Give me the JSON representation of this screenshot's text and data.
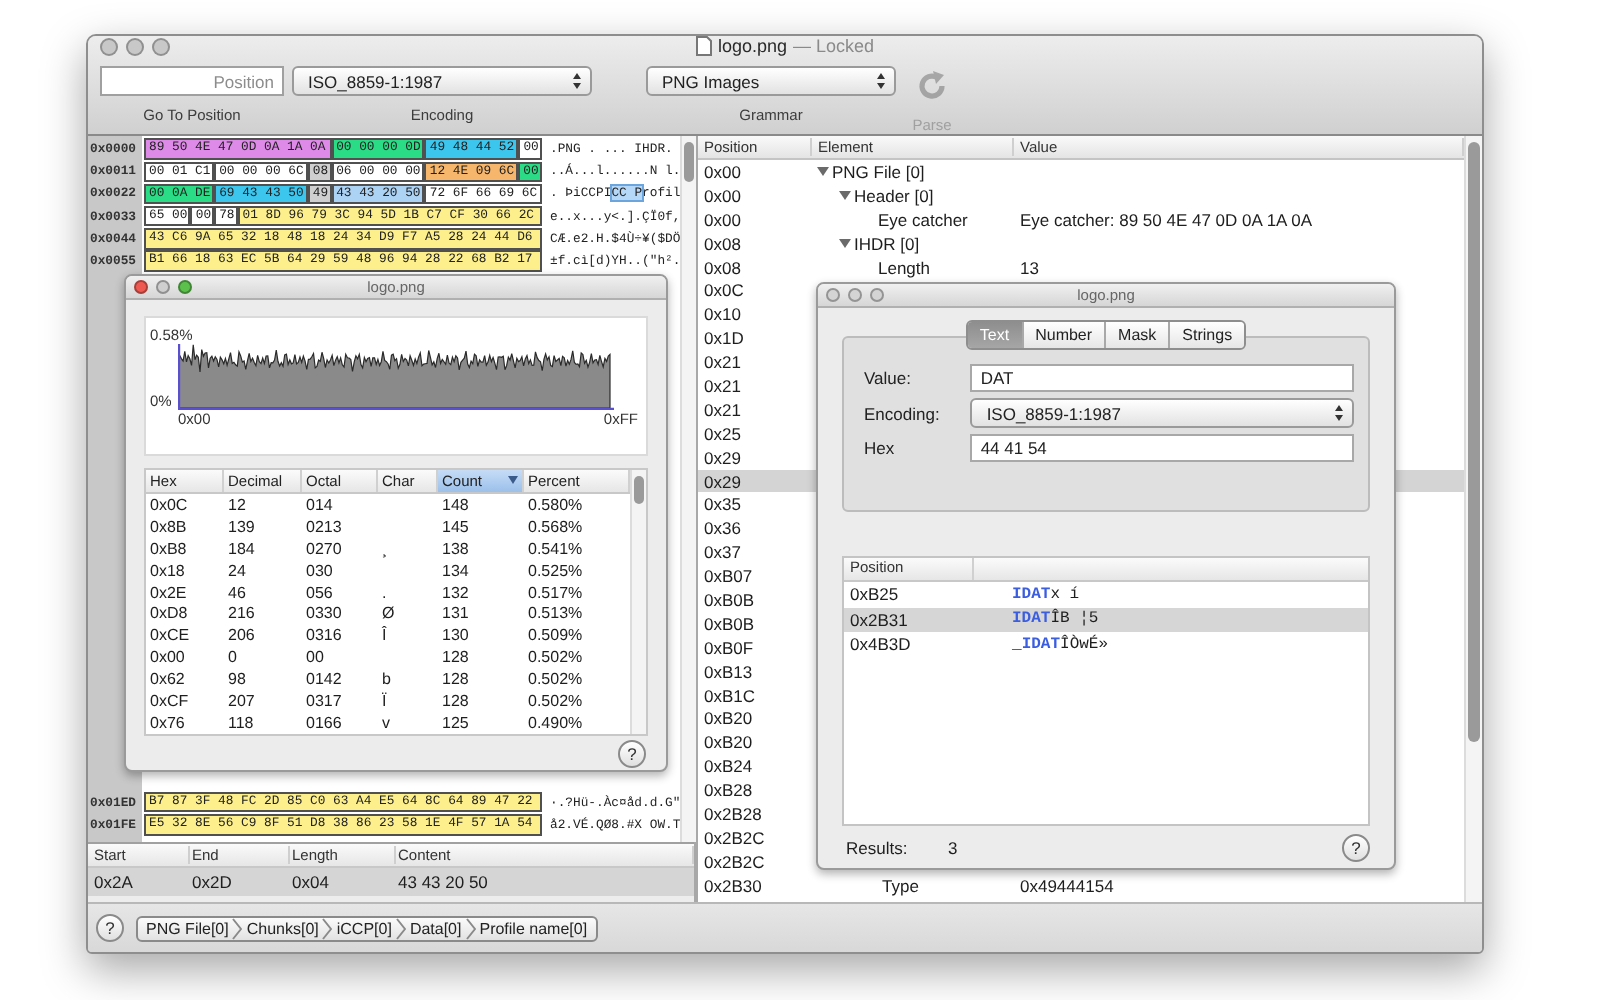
{
  "window": {
    "title": "logo.png",
    "status": "— Locked"
  },
  "toolbar": {
    "position_field": {
      "placeholder": "Position",
      "label": "Go To Position"
    },
    "encoding": {
      "value": "ISO_8859-1:1987",
      "label": "Encoding"
    },
    "grammar": {
      "value": "PNG Images",
      "label": "Grammar"
    },
    "parse": {
      "label": "Parse",
      "disabled": true
    }
  },
  "hex_view": {
    "rows_top": [
      {
        "offset": "0x0000",
        "segments": [
          {
            "bytes": "89 50 4E 47 0D 0A 1A 0A",
            "color": "#de8ae8"
          },
          {
            "bytes": "00 00 00 0D",
            "color": "#2bdc86"
          },
          {
            "bytes": "49 48 44 52",
            "color": "#3cc6ee"
          },
          {
            "bytes": "00",
            "color": "#ffffff"
          }
        ],
        "text": [
          {
            "text": ".PNG . ... IHDR.",
            "selected": false
          }
        ]
      },
      {
        "offset": "0x0011",
        "segments": [
          {
            "bytes": "00 01 C1",
            "color": "#ffffff"
          },
          {
            "bytes": "00 00 00 6C",
            "color": "#ffffff"
          },
          {
            "bytes": "08",
            "color": "#cfcfcf"
          },
          {
            "bytes": "06 00 00 00",
            "color": "#ffffff"
          },
          {
            "bytes": "12 4E 09 6C",
            "color": "#f6b66c"
          },
          {
            "bytes": "00",
            "color": "#2bdc86"
          }
        ],
        "text": [
          {
            "text": "..Á...l......N l.",
            "selected": false
          }
        ]
      },
      {
        "offset": "0x0022",
        "segments": [
          {
            "bytes": "00 0A DE",
            "color": "#2bdc86"
          },
          {
            "bytes": "69 43 43 50",
            "color": "#3cc6ee"
          },
          {
            "bytes": "49",
            "color": "#cfcfcf"
          },
          {
            "bytes": "43 43 20 50",
            "color": "#acd2f4"
          },
          {
            "bytes": "72 6F 66 69 6C",
            "color": "#ffffff"
          }
        ],
        "text": [
          {
            "text": ". ÞiCCPI",
            "selected": false
          },
          {
            "text": "CC P",
            "selected": true
          },
          {
            "text": "rofil",
            "selected": false
          }
        ]
      },
      {
        "offset": "0x0033",
        "segments": [
          {
            "bytes": "65 00",
            "color": "#ffffff"
          },
          {
            "bytes": "00",
            "color": "#ffffff"
          },
          {
            "bytes": "78",
            "color": "#ffffff"
          },
          {
            "bytes": "01 8D 96 79 3C 94 5D 1B C7 CF 30 66 2C",
            "color": "#fdf08c"
          }
        ],
        "text": [
          {
            "text": "e..x...y<.].ÇÏ0f,",
            "selected": false
          }
        ]
      },
      {
        "offset": "0x0044",
        "segments": [
          {
            "bytes": "43 C6 9A 65 32 18 48 18 24 34 D9 F7 A5 28 24 44 D6",
            "color": "#fdf08c"
          }
        ],
        "text": [
          {
            "text": "CÆ.e2.H.$4Ù÷¥($DÖ",
            "selected": false
          }
        ]
      },
      {
        "offset": "0x0055",
        "segments": [
          {
            "bytes": "B1 66 18 63 EC 5B 64 29 59 48 96 94 28 22 68 B2 17",
            "color": "#fdf08c"
          }
        ],
        "text": [
          {
            "text": "±f.cì[d)YH..(\"h².",
            "selected": false
          }
        ]
      }
    ],
    "rows_bottom": [
      {
        "offset": "0x01ED",
        "segments": [
          {
            "bytes": "B7 87 3F 48 FC 2D 85 C0 63 A4 E5 64 8C 64 89 47 22",
            "color": "#fdf08c"
          }
        ],
        "text": [
          {
            "text": "·.?Hü-.Àc¤åd.d.G\"",
            "selected": false
          }
        ]
      },
      {
        "offset": "0x01FE",
        "segments": [
          {
            "bytes": "E5 32 8E 56 C9 8F 51 D8 38 86 23 58 1E 4F 57 1A 54",
            "color": "#fdf08c"
          }
        ],
        "text": [
          {
            "text": "å2.VÉ.QØ8.#X OW.T",
            "selected": false
          }
        ]
      }
    ]
  },
  "selection": {
    "columns": [
      "Start",
      "End",
      "Length",
      "Content"
    ],
    "values": [
      "0x2A",
      "0x2D",
      "0x04",
      "43 43 20 50"
    ]
  },
  "bottom_bar": {
    "help": "?",
    "path": [
      "PNG File[0]",
      "Chunks[0]",
      "iCCP[0]",
      "Data[0]",
      "Profile name[0]"
    ]
  },
  "structure": {
    "columns": [
      "Position",
      "Element",
      "Value"
    ],
    "tree": [
      {
        "position": "0x00",
        "element": "PNG File [0]",
        "expanded": true,
        "selected": false,
        "children": [
          {
            "position": "0x00",
            "element": "Header [0]",
            "expanded": true,
            "selected": false,
            "children": [
              {
                "position": "0x00",
                "element": "Eye catcher",
                "value": "Eye catcher: 89 50 4E 47 0D 0A 1A 0A",
                "selected": false
              }
            ]
          },
          {
            "position": "0x08",
            "element": "IHDR [0]",
            "expanded": true,
            "selected": false,
            "children": [
              {
                "position": "0x08",
                "element": "Length",
                "value": "13",
                "selected": false
              }
            ]
          }
        ]
      }
    ],
    "more_rows": [
      {
        "position": "0x0C",
        "selected": false
      },
      {
        "position": "0x10",
        "selected": false
      },
      {
        "position": "0x1D",
        "selected": false
      },
      {
        "position": "0x21",
        "selected": false
      },
      {
        "position": "0x21",
        "selected": false
      },
      {
        "position": "0x21",
        "selected": false
      },
      {
        "position": "0x25",
        "selected": false
      },
      {
        "position": "0x29",
        "selected": false
      },
      {
        "position": "0x29",
        "selected": true
      },
      {
        "position": "0x35",
        "selected": false
      },
      {
        "position": "0x36",
        "selected": false
      },
      {
        "position": "0x37",
        "selected": false
      },
      {
        "position": "0xB07",
        "selected": false
      },
      {
        "position": "0xB0B",
        "selected": false
      },
      {
        "position": "0xB0B",
        "selected": false
      },
      {
        "position": "0xB0F",
        "selected": false
      },
      {
        "position": "0xB13",
        "selected": false
      },
      {
        "position": "0xB1C",
        "selected": false
      },
      {
        "position": "0xB20",
        "selected": false
      },
      {
        "position": "0xB20",
        "selected": false
      },
      {
        "position": "0xB24",
        "selected": false
      },
      {
        "position": "0xB28",
        "selected": false
      },
      {
        "position": "0x2B28",
        "selected": false
      },
      {
        "position": "0x2B2C",
        "selected": false
      },
      {
        "position": "0x2B2C",
        "selected": false
      },
      {
        "position": "0x2B30",
        "element": "Type",
        "value": "0x49444154",
        "selected": false
      }
    ]
  },
  "histogram_window": {
    "title": "logo.png",
    "y_max": "0.58%",
    "y_min": "0%",
    "x_min": "0x00",
    "x_max": "0xFF",
    "columns": [
      {
        "label": "Hex",
        "sorted": false
      },
      {
        "label": "Decimal",
        "sorted": false
      },
      {
        "label": "Octal",
        "sorted": false
      },
      {
        "label": "Char",
        "sorted": false
      },
      {
        "label": "Count",
        "sorted": true
      },
      {
        "label": "Percent",
        "sorted": false
      }
    ],
    "rows": [
      {
        "hex": "0x0C",
        "decimal": "12",
        "octal": "014",
        "count": "148",
        "percent": "0.580%"
      },
      {
        "hex": "0x8B",
        "decimal": "139",
        "octal": "0213",
        "count": "145",
        "percent": "0.568%"
      },
      {
        "hex": "0xB8",
        "decimal": "184",
        "octal": "0270",
        "char": "¸",
        "count": "138",
        "percent": "0.541%"
      },
      {
        "hex": "0x18",
        "decimal": "24",
        "octal": "030",
        "count": "134",
        "percent": "0.525%"
      },
      {
        "hex": "0x2E",
        "decimal": "46",
        "octal": "056",
        "char": ".",
        "count": "132",
        "percent": "0.517%"
      },
      {
        "hex": "0xD8",
        "decimal": "216",
        "octal": "0330",
        "char": "Ø",
        "count": "131",
        "percent": "0.513%"
      },
      {
        "hex": "0xCE",
        "decimal": "206",
        "octal": "0316",
        "char": "Î",
        "count": "130",
        "percent": "0.509%"
      },
      {
        "hex": "0x00",
        "decimal": "0",
        "octal": "00",
        "count": "128",
        "percent": "0.502%"
      },
      {
        "hex": "0x62",
        "decimal": "98",
        "octal": "0142",
        "char": "b",
        "count": "128",
        "percent": "0.502%"
      },
      {
        "hex": "0xCF",
        "decimal": "207",
        "octal": "0317",
        "char": "Ï",
        "count": "128",
        "percent": "0.502%"
      },
      {
        "hex": "0x76",
        "decimal": "118",
        "octal": "0166",
        "char": "v",
        "count": "125",
        "percent": "0.490%"
      }
    ],
    "help": "?"
  },
  "inspector_window": {
    "title": "logo.png",
    "tabs": [
      {
        "label": "Text",
        "selected": true
      },
      {
        "label": "Number",
        "selected": false
      },
      {
        "label": "Mask",
        "selected": false
      },
      {
        "label": "Strings",
        "selected": false
      }
    ],
    "value_label": "Value:",
    "value": "DAT",
    "encoding_label": "Encoding:",
    "encoding": "ISO_8859-1:1987",
    "hex_label": "Hex",
    "hex": "44 41 54",
    "results_column": "Position",
    "results": [
      {
        "position": "0xB25",
        "match": "IDAT",
        "rest": "x í",
        "selected": false
      },
      {
        "position": "0x2B31",
        "match": "IDAT",
        "rest": "ÎB ¦5",
        "selected": true
      },
      {
        "position": "0x4B3D",
        "prefix": "_",
        "match": "IDAT",
        "rest": "ÎÒwÉ»",
        "selected": false
      }
    ],
    "results_label": "Results:",
    "results_count": "3",
    "help": "?"
  }
}
